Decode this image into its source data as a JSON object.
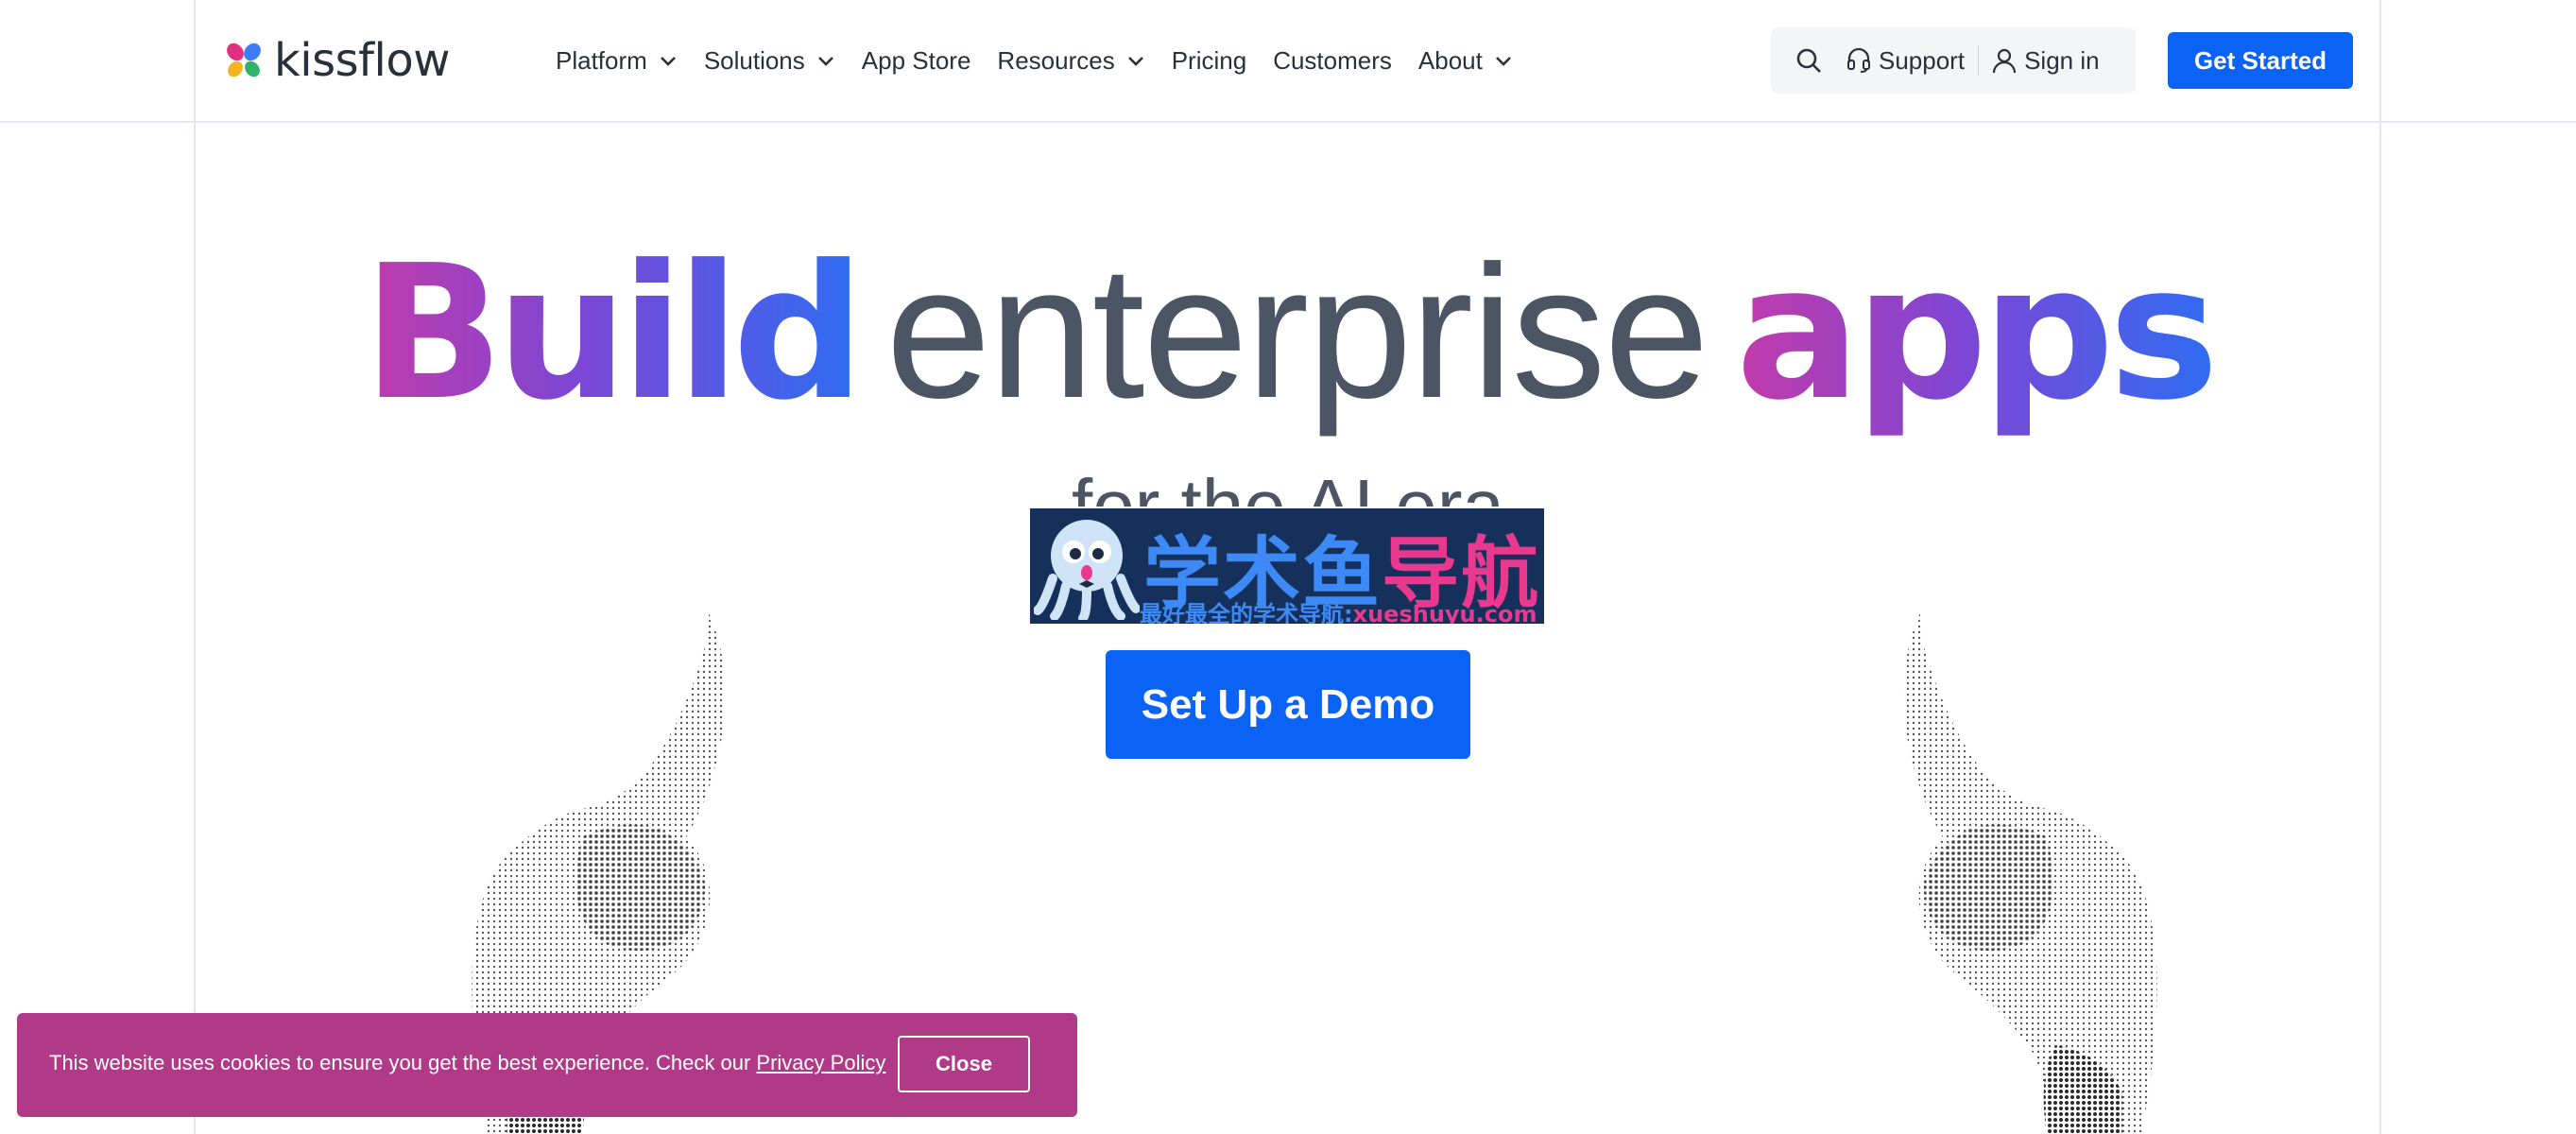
{
  "colors": {
    "accent": "#0b63f6",
    "brand_pink": "#c13bab",
    "brand_purple": "#7a47d6",
    "cookie_bg": "#b03a88"
  },
  "header": {
    "logo_text": "kissflow",
    "nav": [
      {
        "label": "Platform",
        "has_dropdown": true
      },
      {
        "label": "Solutions",
        "has_dropdown": true
      },
      {
        "label": "App Store",
        "has_dropdown": false
      },
      {
        "label": "Resources",
        "has_dropdown": true
      },
      {
        "label": "Pricing",
        "has_dropdown": false
      },
      {
        "label": "Customers",
        "has_dropdown": false
      },
      {
        "label": "About",
        "has_dropdown": true
      }
    ],
    "utility": {
      "search_icon": "search-icon",
      "support_label": "Support",
      "support_icon": "headset-icon",
      "signin_label": "Sign in",
      "signin_icon": "user-icon"
    },
    "cta_label": "Get Started"
  },
  "hero": {
    "title_word1": "Build",
    "title_word2": "enterprise",
    "title_word3": "apps",
    "subtitle": "for the AI era",
    "demo_label": "Set Up a Demo"
  },
  "watermark": {
    "title_part1": "学术鱼",
    "title_part2": "导航",
    "sub_part1": "最好最全的学术导航:",
    "sub_part2": "xueshuyu.com"
  },
  "cookie": {
    "text": "This website uses cookies to ensure you get the best experience. Check our",
    "link_label": "Privacy Policy",
    "close_label": "Close"
  }
}
